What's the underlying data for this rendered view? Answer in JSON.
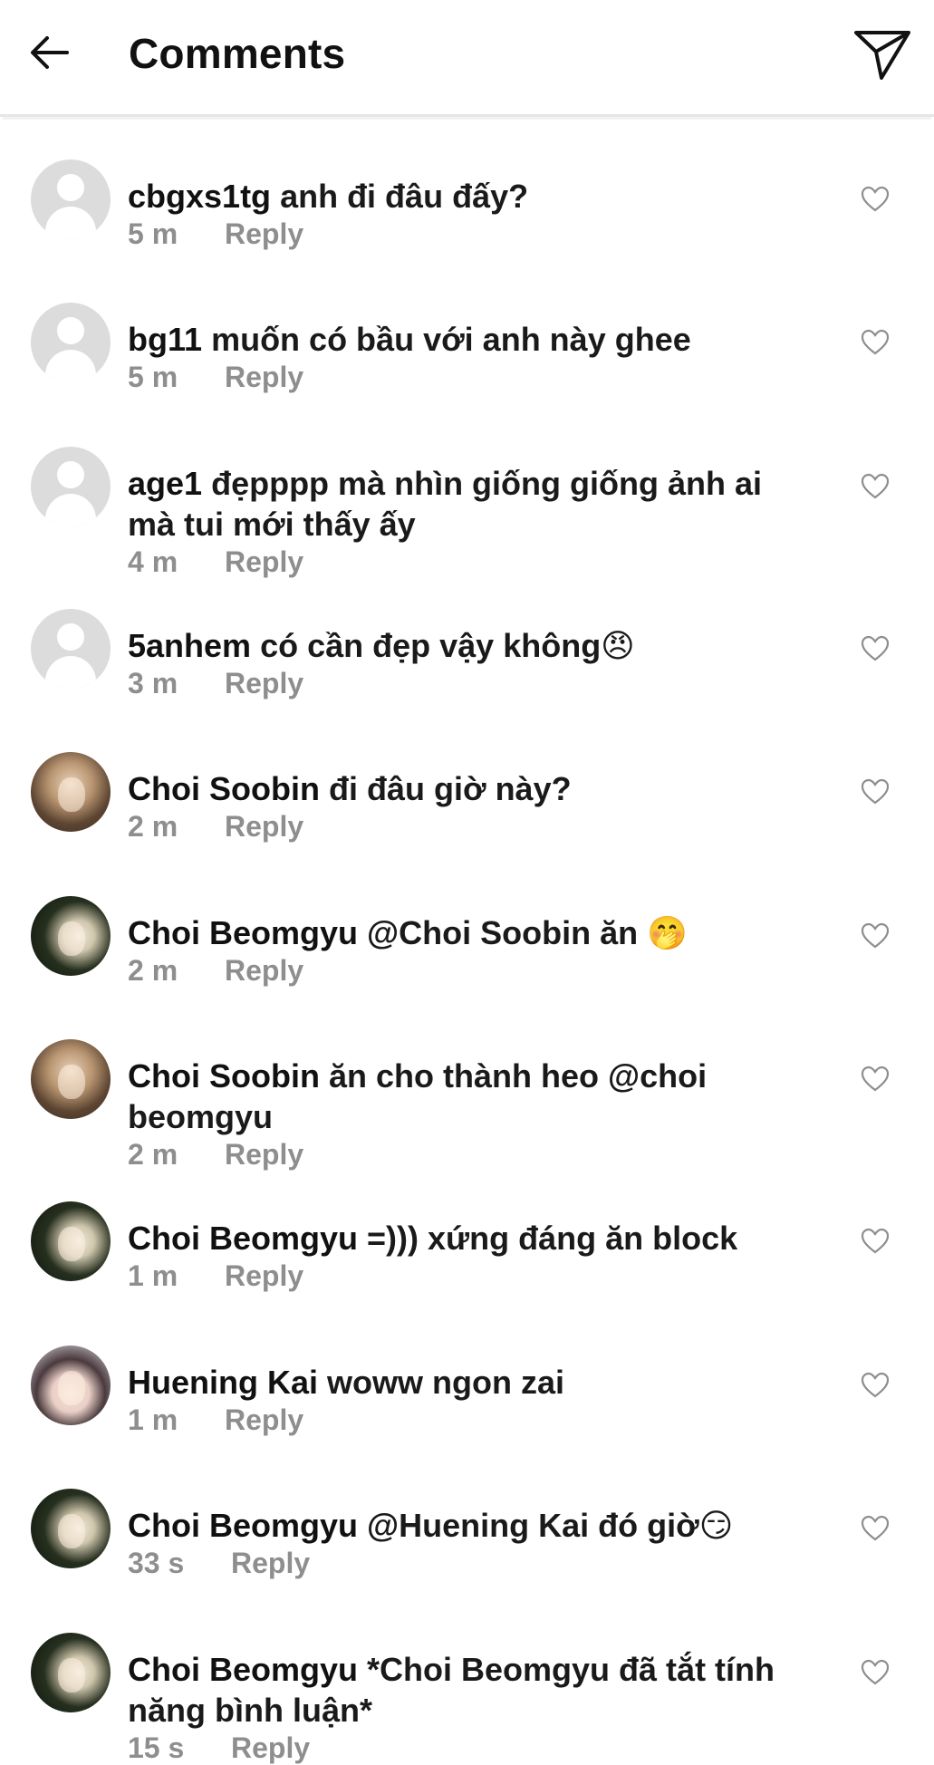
{
  "header": {
    "title": "Comments",
    "back_icon": "arrow-left-icon",
    "send_icon": "paper-plane-icon"
  },
  "colors": {
    "meta_gray": "#8e8e8e",
    "text": "#111111",
    "default_avatar": "#dcdcdc"
  },
  "comments": [
    {
      "username": "cbgxs1tg",
      "text": "anh đi đâu đấy?",
      "time": "5 m",
      "reply_label": "Reply",
      "avatar": "default"
    },
    {
      "username": "bg11",
      "text": "muốn có bầu với anh này ghee",
      "time": "5 m",
      "reply_label": "Reply",
      "avatar": "default"
    },
    {
      "username": "age1",
      "text": "đẹpppp mà nhìn giống giống ảnh ai mà tui mới thấy ấy",
      "time": "4 m",
      "reply_label": "Reply",
      "avatar": "default"
    },
    {
      "username": "5anhem",
      "text": "có cần đẹp vậy không😠",
      "time": "3 m",
      "reply_label": "Reply",
      "avatar": "default"
    },
    {
      "username": "Choi Soobin",
      "text": "đi đâu giờ này?",
      "time": "2 m",
      "reply_label": "Reply",
      "avatar": "soobin"
    },
    {
      "username": "Choi Beomgyu",
      "text": "@Choi Soobin ăn 🤭",
      "time": "2 m",
      "reply_label": "Reply",
      "avatar": "beomgyu"
    },
    {
      "username": "Choi Soobin",
      "text": "ăn cho thành heo @choi beomgyu",
      "time": "2 m",
      "reply_label": "Reply",
      "avatar": "soobin"
    },
    {
      "username": "Choi Beomgyu",
      "text": "=))) xứng đáng ăn block",
      "time": "1 m",
      "reply_label": "Reply",
      "avatar": "beomgyu"
    },
    {
      "username": "Huening Kai",
      "text": "woww ngon zai",
      "time": "1 m",
      "reply_label": "Reply",
      "avatar": "kai"
    },
    {
      "username": "Choi Beomgyu",
      "text": "@Huening Kai đó giờ😏",
      "time": "33 s",
      "reply_label": "Reply",
      "avatar": "beomgyu"
    },
    {
      "username": "Choi Beomgyu",
      "text": "*Choi Beomgyu đã tắt tính năng bình luận*",
      "time": "15 s",
      "reply_label": "Reply",
      "avatar": "beomgyu"
    }
  ]
}
